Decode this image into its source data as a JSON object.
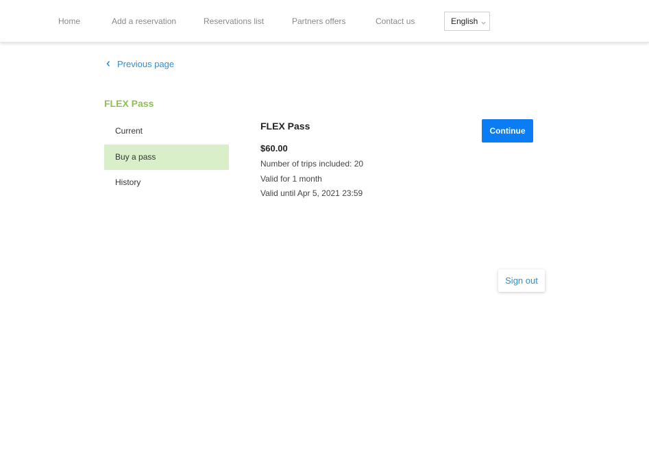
{
  "nav": {
    "items": [
      {
        "label": "Home"
      },
      {
        "label": "Add a reservation"
      },
      {
        "label": "Reservations list"
      },
      {
        "label": "Partners offers"
      },
      {
        "label": "Contact us"
      }
    ],
    "language": {
      "selected": "English",
      "icon": "chevron-down-icon"
    }
  },
  "back": {
    "label": "Previous page",
    "icon": "chevron-left-icon"
  },
  "section": {
    "title": "FLEX Pass"
  },
  "sidebar": {
    "items": [
      {
        "label": "Current",
        "active": false
      },
      {
        "label": "Buy a pass",
        "active": true
      },
      {
        "label": "History",
        "active": false
      }
    ]
  },
  "pass": {
    "name": "FLEX Pass",
    "price": "$60.00",
    "details": [
      "Number of trips included: 20",
      "Valid for 1 month",
      "Valid until Apr 5, 2021 23:59"
    ]
  },
  "actions": {
    "continue_label": "Continue",
    "signout_label": "Sign out"
  },
  "colors": {
    "accent_green": "#8cc152",
    "active_bg": "#d9efc9",
    "primary_blue": "#0a7df5",
    "link_blue": "#2b8fd6"
  }
}
